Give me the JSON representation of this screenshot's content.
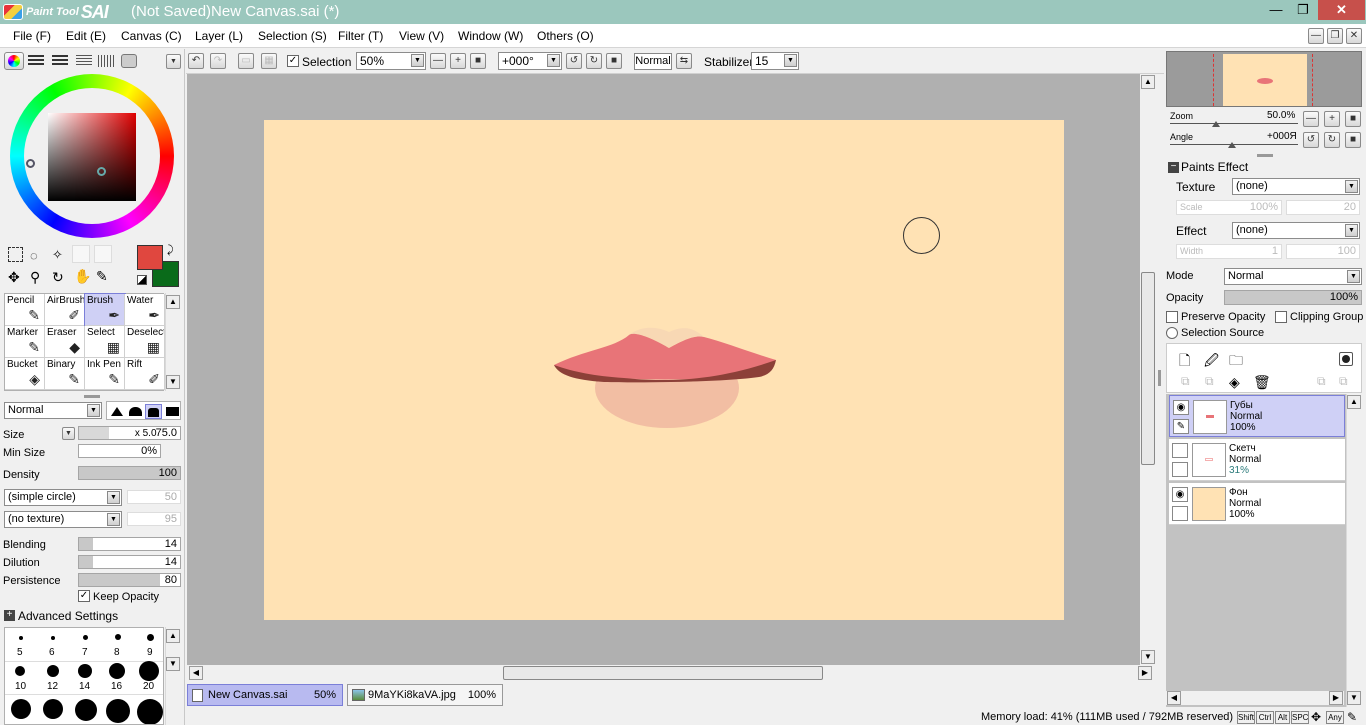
{
  "window": {
    "logo_small": "Paint Tool",
    "logo_big": "SAI",
    "title": "(Not Saved)New Canvas.sai (*)",
    "minimize": "—",
    "maximize": "❐",
    "close": "✕"
  },
  "menu": [
    "File (F)",
    "Edit (E)",
    "Canvas (C)",
    "Layer (L)",
    "Selection (S)",
    "Filter (T)",
    "View (V)",
    "Window (W)",
    "Others (O)"
  ],
  "toolbar": {
    "selection_label": "Selection",
    "zoom_value": "50%",
    "angle_value": "+000°",
    "blend_mode": "Normal",
    "stabilizer_label": "Stabilizer",
    "stabilizer_value": "15"
  },
  "colors": {
    "primary": "#e0473f",
    "secondary": "#0a6b1a",
    "canvas_bg": "#ffe2b4",
    "workspace": "#b0b0b0",
    "selection_accent": "#cfd0f5"
  },
  "tools": [
    {
      "name": "Pencil",
      "icon": "pencil-icon"
    },
    {
      "name": "AirBrush",
      "icon": "airbrush-icon"
    },
    {
      "name": "Brush",
      "icon": "brush-icon"
    },
    {
      "name": "Water",
      "icon": "water-icon"
    },
    {
      "name": "Marker",
      "icon": "marker-icon"
    },
    {
      "name": "Eraser",
      "icon": "eraser-icon"
    },
    {
      "name": "Select",
      "icon": "select-icon"
    },
    {
      "name": "Deselect",
      "icon": "deselect-icon"
    },
    {
      "name": "Bucket",
      "icon": "bucket-icon"
    },
    {
      "name": "Binary",
      "icon": "binary-icon"
    },
    {
      "name": "Ink Pen",
      "icon": "ink-pen-icon"
    },
    {
      "name": "Rift",
      "icon": "rift-icon"
    }
  ],
  "selected_tool": "Brush",
  "brush": {
    "blend_mode": "Normal",
    "size_label": "Size",
    "size_mult": "x 5.0",
    "size_value": "75.0",
    "min_size_label": "Min Size",
    "min_size_value": "0%",
    "density_label": "Density",
    "density_value": "100",
    "shape": "(simple circle)",
    "shape_value": "50",
    "texture": "(no texture)",
    "texture_value": "95",
    "blending_label": "Blending",
    "blending_value": "14",
    "dilution_label": "Dilution",
    "dilution_value": "14",
    "persistence_label": "Persistence",
    "persistence_value": "80",
    "keep_opacity_label": "Keep Opacity",
    "advanced_label": "Advanced Settings",
    "brush_sizes_row1": [
      "5",
      "6",
      "7",
      "8",
      "9"
    ],
    "brush_sizes_row2": [
      "10",
      "12",
      "14",
      "16",
      "20"
    ]
  },
  "navigator": {
    "zoom_label": "Zoom",
    "zoom_value": "50.0%",
    "angle_label": "Angle",
    "angle_value": "+000Я"
  },
  "paints_effect": {
    "header": "Paints Effect",
    "texture_label": "Texture",
    "texture_value": "(none)",
    "scale_label": "Scale",
    "scale_value": "100%",
    "scale_value2": "20",
    "effect_label": "Effect",
    "effect_value": "(none)",
    "width_label": "Width",
    "width_value": "1",
    "width_value2": "100"
  },
  "layer_props": {
    "mode_label": "Mode",
    "mode_value": "Normal",
    "opacity_label": "Opacity",
    "opacity_value": "100%",
    "preserve_opacity": "Preserve Opacity",
    "clipping_group": "Clipping Group",
    "selection_source": "Selection Source"
  },
  "layers": [
    {
      "name": "Губы",
      "mode": "Normal",
      "opacity": "100%",
      "selected": true
    },
    {
      "name": "Скетч",
      "mode": "Normal",
      "opacity": "31%",
      "selected": false
    },
    {
      "name": "Фон",
      "mode": "Normal",
      "opacity": "100%",
      "selected": false
    }
  ],
  "tabs": [
    {
      "name": "New Canvas.sai",
      "zoom": "50%"
    },
    {
      "name": "9MaYKi8kaVA.jpg",
      "zoom": "100%"
    }
  ],
  "status": {
    "memory": "Memory load: 41% (111MB used / 792MB reserved)",
    "keys": [
      "Shift",
      "Ctrl",
      "Alt",
      "SPC",
      "Any"
    ]
  }
}
